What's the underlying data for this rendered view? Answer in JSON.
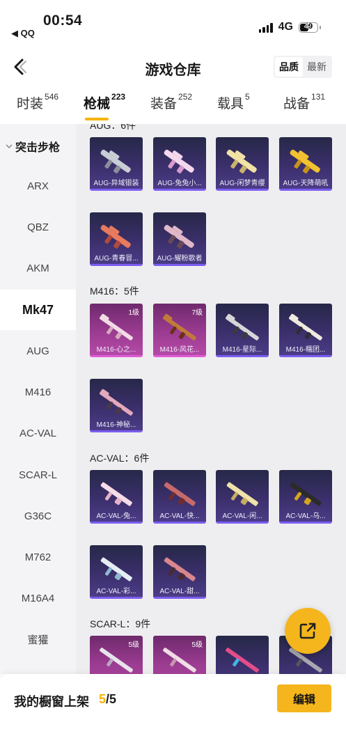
{
  "status_bar": {
    "time": "00:54",
    "back_app": "◀ QQ",
    "network": "4G",
    "battery": "49"
  },
  "nav": {
    "title": "游戏仓库",
    "sort_options": [
      "品质",
      "最新"
    ]
  },
  "tabs": [
    {
      "label": "时装",
      "count": "546"
    },
    {
      "label": "枪械",
      "count": "223"
    },
    {
      "label": "装备",
      "count": "252"
    },
    {
      "label": "载具",
      "count": "5"
    },
    {
      "label": "战备",
      "count": "131"
    }
  ],
  "sidebar": {
    "header": "突击步枪",
    "items": [
      "ARX",
      "QBZ",
      "AKM",
      "Mk47",
      "AUG",
      "M416",
      "AC-VAL",
      "SCAR-L",
      "G36C",
      "M762",
      "M16A4",
      "蜜獾"
    ]
  },
  "groups": {
    "aug": {
      "title": "AUG：6件",
      "items": [
        {
          "name": "AUG-异域银装"
        },
        {
          "name": "AUG-兔兔小..."
        },
        {
          "name": "AUG-闲梦青缨"
        },
        {
          "name": "AUG-天降萌吼"
        },
        {
          "name": "AUG-青春冒..."
        },
        {
          "name": "AUG-耀粉歌者"
        }
      ]
    },
    "m416": {
      "title": "M416：5件",
      "items": [
        {
          "name": "M416-心之...",
          "level": "1级"
        },
        {
          "name": "M416-风花...",
          "level": "7级"
        },
        {
          "name": "M416-星际..."
        },
        {
          "name": "M416-糯团..."
        },
        {
          "name": "M416-神秘..."
        }
      ]
    },
    "acval": {
      "title": "AC-VAL：6件",
      "items": [
        {
          "name": "AC-VAL-兔..."
        },
        {
          "name": "AC-VAL-快..."
        },
        {
          "name": "AC-VAL-闲..."
        },
        {
          "name": "AC-VAL-乌..."
        },
        {
          "name": "AC-VAL-彩..."
        },
        {
          "name": "AC-VAL-甜..."
        }
      ]
    },
    "scarl": {
      "title": "SCAR-L：9件",
      "items": [
        {
          "level": "5级"
        },
        {
          "level": "5级"
        }
      ]
    }
  },
  "bottom": {
    "label": "我的橱窗上架",
    "current": "5",
    "total": "/5",
    "edit": "编辑"
  }
}
